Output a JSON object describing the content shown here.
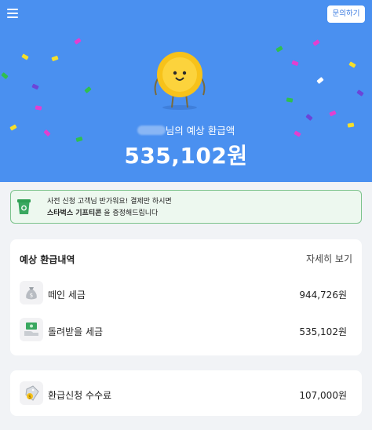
{
  "header": {
    "inquiry_label": "문의하기"
  },
  "hero": {
    "name_suffix": "님의 예상 환급액",
    "amount": "535,102원"
  },
  "promo": {
    "line1": "사전 신청 고객님 반가워요! 결제만 하시면",
    "line2_bold": "스타벅스 기프티콘",
    "line2_rest": " 을 증정해드립니다"
  },
  "refund": {
    "title": "예상 환급내역",
    "detail_link": "자세히 보기",
    "rows": [
      {
        "label": "떼인 세금",
        "value": "944,726원",
        "icon": "money-bag-icon"
      },
      {
        "label": "돌려받을 세금",
        "value": "535,102원",
        "icon": "cash-hand-icon"
      }
    ]
  },
  "fee": {
    "label": "환급신청 수수료",
    "value": "107,000원",
    "icon": "price-tag-icon"
  },
  "colors": {
    "hero_bg": "#4a90f0",
    "promo_bg": "#edf8ef",
    "promo_border": "#7cc38c",
    "coin": "#f7c21a"
  }
}
